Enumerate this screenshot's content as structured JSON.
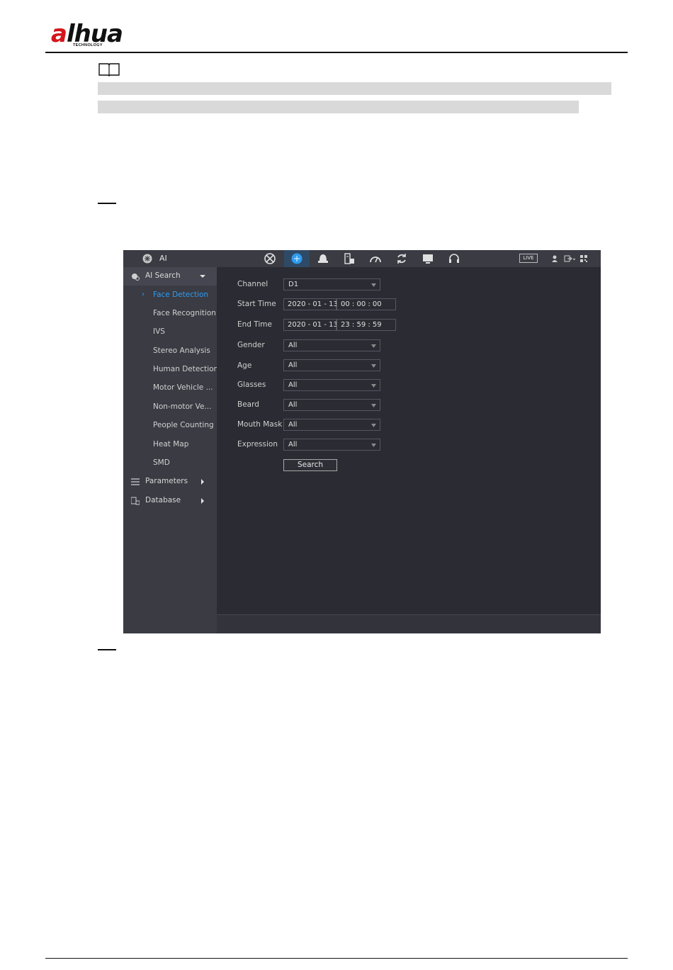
{
  "header": {
    "logo_text": "alhua",
    "logo_subtext": "TECHNOLOGY",
    "brand_color": "#d4161c"
  },
  "screenshot": {
    "topbar": {
      "title": "AI",
      "nav_icons": [
        "network-icon",
        "ai-icon",
        "storage-icon",
        "device-icon",
        "performance-icon",
        "sync-icon",
        "display-icon",
        "audio-icon"
      ],
      "active_icon": "ai-icon",
      "live_label": "LIVE"
    },
    "sidebar": {
      "ai_search": {
        "label": "AI Search",
        "items": [
          {
            "label": "Face Detection",
            "active": true
          },
          {
            "label": "Face Recognition"
          },
          {
            "label": "IVS"
          },
          {
            "label": "Stereo Analysis"
          },
          {
            "label": "Human Detection"
          },
          {
            "label": "Motor Vehicle ..."
          },
          {
            "label": "Non-motor Ve..."
          },
          {
            "label": "People Counting"
          },
          {
            "label": "Heat Map"
          },
          {
            "label": "SMD"
          }
        ]
      },
      "parameters": {
        "label": "Parameters"
      },
      "database": {
        "label": "Database"
      }
    },
    "form": {
      "channel": {
        "label": "Channel",
        "value": "D1"
      },
      "start_time": {
        "label": "Start Time",
        "date": "2020 - 01 - 13",
        "time": "00 : 00 : 00"
      },
      "end_time": {
        "label": "End Time",
        "date": "2020 - 01 - 13",
        "time": "23 : 59 : 59"
      },
      "gender": {
        "label": "Gender",
        "value": "All"
      },
      "age": {
        "label": "Age",
        "value": "All"
      },
      "glasses": {
        "label": "Glasses",
        "value": "All"
      },
      "beard": {
        "label": "Beard",
        "value": "All"
      },
      "mouth_mask": {
        "label": "Mouth Mask",
        "value": "All"
      },
      "expression": {
        "label": "Expression",
        "value": "All"
      },
      "search_label": "Search"
    },
    "colors": {
      "accent": "#2f9cf0",
      "panel": "#2b2c33",
      "sidebar": "#3a3b43"
    }
  }
}
